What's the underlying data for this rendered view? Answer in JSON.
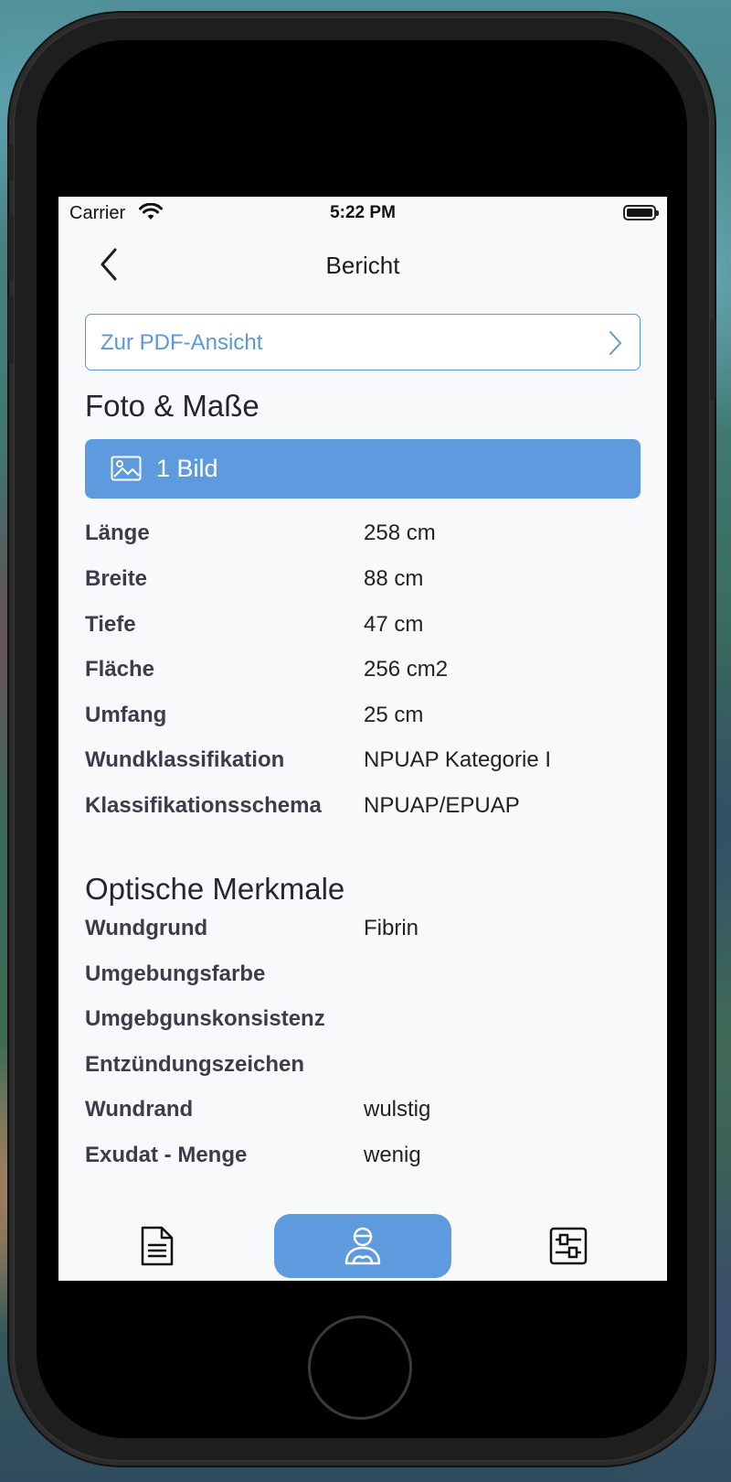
{
  "status_bar": {
    "carrier": "Carrier",
    "time": "5:22 PM"
  },
  "nav": {
    "title": "Bericht",
    "back_icon": "chevron-left-icon"
  },
  "pdf_link": {
    "label": "Zur PDF-Ansicht",
    "icon": "chevron-right-icon"
  },
  "section_photo": {
    "title": "Foto & Maße",
    "images_button": {
      "label": "1 Bild",
      "icon": "image-icon"
    },
    "rows": [
      {
        "key": "Länge",
        "value": "258 cm"
      },
      {
        "key": "Breite",
        "value": "88 cm"
      },
      {
        "key": "Tiefe",
        "value": "47 cm"
      },
      {
        "key": "Fläche",
        "value": "256 cm2"
      },
      {
        "key": "Umfang",
        "value": "25 cm"
      },
      {
        "key": "Wundklassifikation",
        "value": "NPUAP Kategorie I"
      },
      {
        "key": "Klassifikationsschema",
        "value": "NPUAP/EPUAP"
      }
    ]
  },
  "section_optical": {
    "title": "Optische Merkmale",
    "rows": [
      {
        "key": "Wundgrund",
        "value": "Fibrin"
      },
      {
        "key": "Umgebungsfarbe",
        "value": ""
      },
      {
        "key": "Umgebgunskonsistenz",
        "value": ""
      },
      {
        "key": "Entzündungszeichen",
        "value": ""
      },
      {
        "key": "Wundrand",
        "value": "wulstig"
      },
      {
        "key": "Exudat - Menge",
        "value": "wenig"
      }
    ]
  },
  "tabbar": {
    "accent_color": "#5d9ade",
    "tabs": [
      {
        "icon": "document-icon",
        "active": false
      },
      {
        "icon": "patient-icon",
        "active": true
      },
      {
        "icon": "settings-sliders-icon",
        "active": false
      }
    ]
  }
}
